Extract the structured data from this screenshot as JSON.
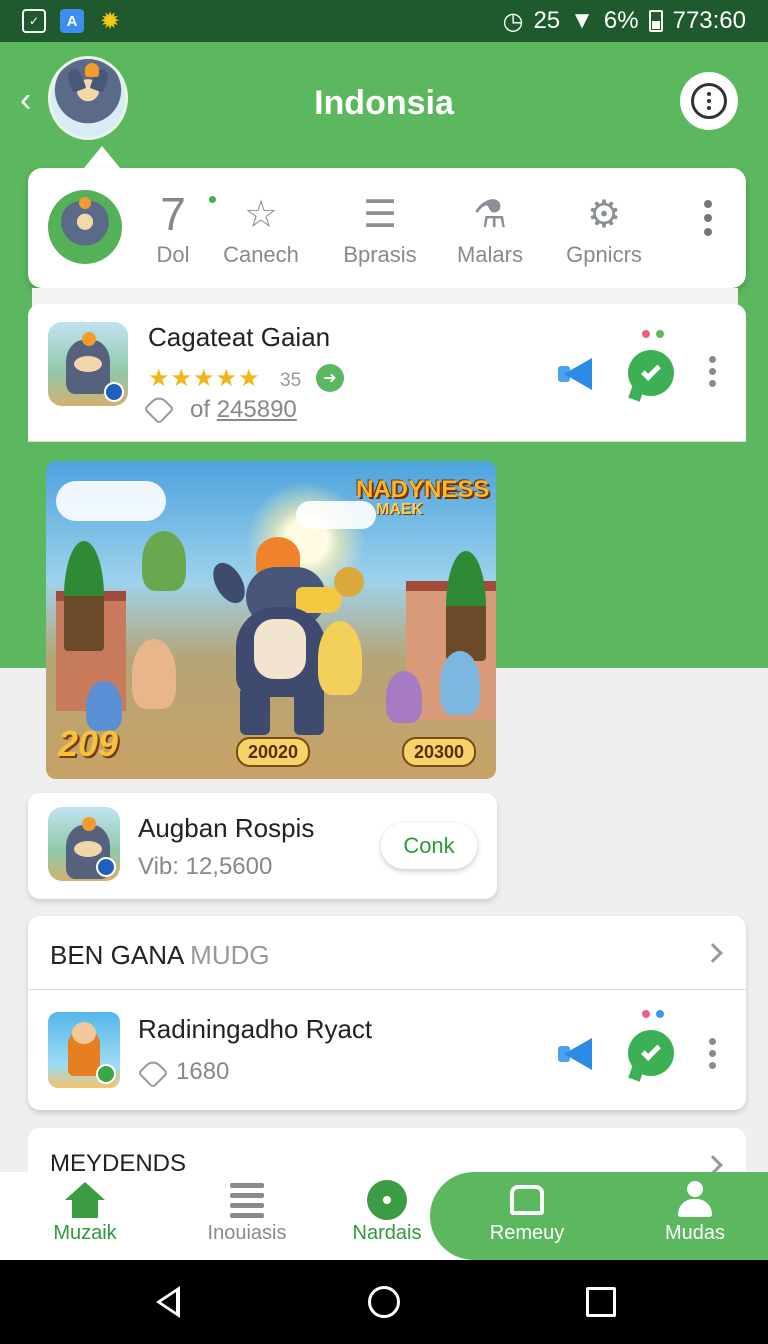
{
  "status_bar": {
    "left_icons": [
      "gallery-icon",
      "translate-icon",
      "settings-gear-icon"
    ],
    "icon_a_label": "✓",
    "icon_b_label": "A",
    "alarm_text": "25",
    "battery_text": "6%",
    "time": "773:60"
  },
  "header": {
    "title": "Indonsia",
    "back_icon": "chevron-left-icon",
    "more_icon": "more-options-icon"
  },
  "tabs": [
    {
      "label": "Dol",
      "value": "7",
      "icon": "number"
    },
    {
      "label": "Canech",
      "icon": "star-icon"
    },
    {
      "label": "Bprasis",
      "icon": "list-icon"
    },
    {
      "label": "Malars",
      "icon": "bottle-icon"
    },
    {
      "label": "Gpnicrs",
      "icon": "gear-icon"
    }
  ],
  "app_card": {
    "title": "Cagateat Gaian",
    "rating_count": "35",
    "stars": "★★★★★",
    "count_prefix": "of",
    "count_value": "245890"
  },
  "banner": {
    "title": "NADYNESS",
    "subtitle": "MAEK",
    "left_label": "209",
    "chip_left": "20020",
    "chip_right": "20300"
  },
  "card2": {
    "title": "Augban Rospis",
    "subtitle": "Vib: 12,5600",
    "button_label": "Conk"
  },
  "section": {
    "title_main": "BEN GANA ",
    "title_muted": "MUDG",
    "item_title": "Radiningadho Ryact",
    "item_count": "1680"
  },
  "section2": {
    "title": "MEYDENDS"
  },
  "bottom_nav": [
    {
      "label": "Muzaik",
      "icon": "home-icon",
      "color": "#2e9a3c"
    },
    {
      "label": "Inouiasis",
      "icon": "list-icon",
      "color": "#8a8a8a"
    },
    {
      "label": "Nardais",
      "icon": "gear-icon",
      "color": "#2e9a3c"
    },
    {
      "label": "Remeuy",
      "icon": "store-icon",
      "color": "#ffffff"
    },
    {
      "label": "Mudas",
      "icon": "person-icon",
      "color": "#ffffff"
    }
  ],
  "colors": {
    "primary_green": "#5cb85f",
    "status_bar": "#1f5a2e",
    "accent_blue": "#2d8be8",
    "star_yellow": "#f3b617"
  }
}
